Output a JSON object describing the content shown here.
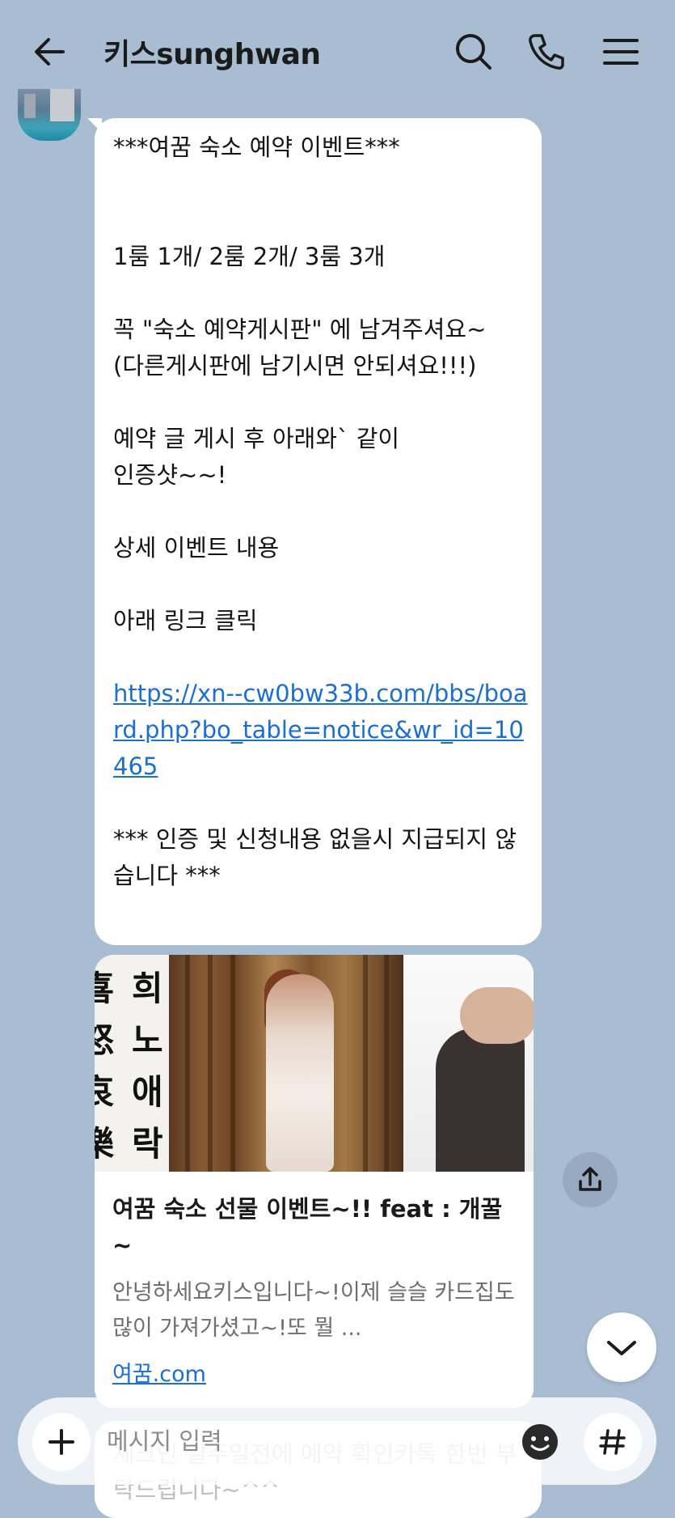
{
  "header": {
    "title": "키스sunghwan",
    "back_icon": "arrow-left-icon",
    "search_icon": "search-icon",
    "call_icon": "phone-icon",
    "menu_icon": "menu-icon"
  },
  "message": {
    "line_title": "***여꿈 숙소 예약 이벤트***",
    "line_rooms": "1룸 1개/ 2룸 2개/ 3룸 3개",
    "line_board1": "꼭  \"숙소 예약게시판\" 에 남겨주셔요~",
    "line_board2": "(다른게시판에 남기시면 안되셔요!!!)",
    "line_post1": "예약 글 게시 후 아래와` 같이",
    "line_post2": "인증샷~~!",
    "line_detail": "상세 이벤트 내용",
    "line_click": "아래 링크 클릭",
    "link": "https://xn--cw0bw33b.com/bbs/board.php?bo_table=notice&wr_id=10465",
    "line_warning": "*** 인증 및 신청내용 없을시 지급되지 않습니다 ***"
  },
  "card": {
    "image_calligraphy": [
      "희",
      "노",
      "애",
      "락",
      "喜",
      "怒",
      "哀",
      "樂"
    ],
    "title": "여꿈 숙소 선물 이벤트~!! feat : 개꿀~",
    "description": "안녕하세요키스입니다~!이제 슬슬 카드집도 많이 가져가셨고~!또 뭘 ...",
    "url": "여꿈.com"
  },
  "peek_message": "체크인 일주일전에 예약 확인카톡 한번 부탁드립니다~^^",
  "input": {
    "placeholder": "메시지 입력"
  },
  "icons": {
    "share": "share-icon",
    "scroll_down": "chevron-down-icon",
    "plus": "plus-icon",
    "emoji": "emoji-icon",
    "hashtag": "hashtag-icon"
  },
  "colors": {
    "background": "#a8bcd2",
    "link": "#1a6fd4"
  }
}
